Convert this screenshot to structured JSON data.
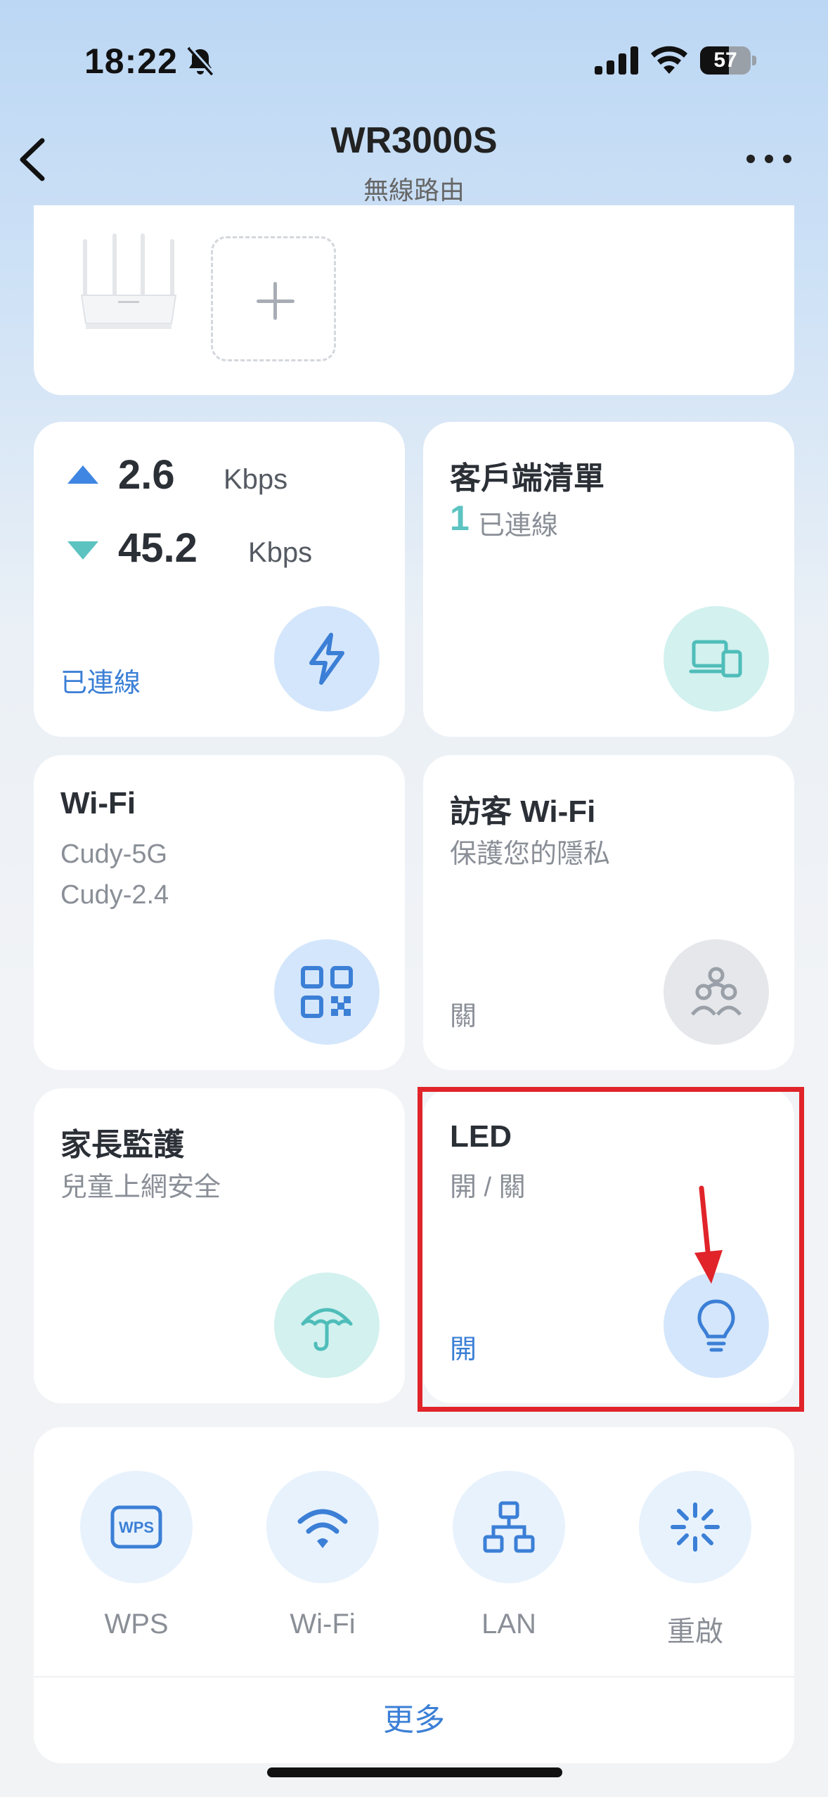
{
  "status_bar": {
    "time": "18:22",
    "battery": "57",
    "battery_level": 0.57
  },
  "nav": {
    "title": "WR3000S",
    "subtitle": "無線路由"
  },
  "speed": {
    "upload_value": "2.6",
    "upload_unit": "Kbps",
    "download_value": "45.2",
    "download_unit": "Kbps",
    "status": "已連線"
  },
  "clients": {
    "title": "客戶端清單",
    "count": "1",
    "count_label": "已連線"
  },
  "wifi": {
    "title": "Wi-Fi",
    "ssid_5g": "Cudy-5G",
    "ssid_24": "Cudy-2.4"
  },
  "guest": {
    "title": "訪客 Wi-Fi",
    "subtitle": "保護您的隱私",
    "status": "關"
  },
  "parental": {
    "title": "家長監護",
    "subtitle": "兒童上網安全"
  },
  "led": {
    "title": "LED",
    "subtitle": "開 / 關",
    "status": "開"
  },
  "quick_actions": [
    {
      "label": "WPS",
      "icon": "wps-icon"
    },
    {
      "label": "Wi-Fi",
      "icon": "wifi-icon"
    },
    {
      "label": "LAN",
      "icon": "lan-icon"
    },
    {
      "label": "重啟",
      "icon": "restart-icon"
    }
  ],
  "more_label": "更多",
  "wps_icon_text": "WPS",
  "colors": {
    "accent_blue": "#3b7fd6",
    "teal": "#5cc3c1",
    "highlight_red": "#e0242a"
  }
}
